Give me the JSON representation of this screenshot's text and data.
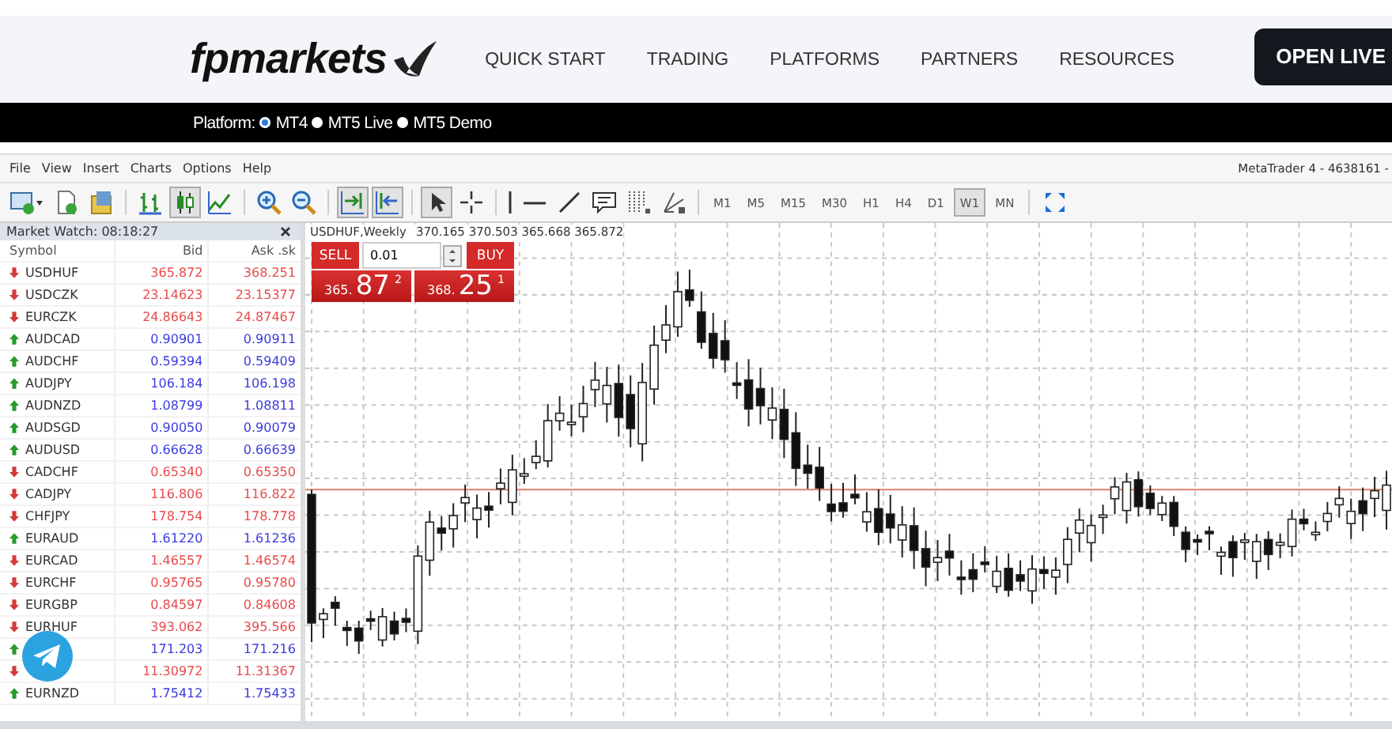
{
  "site": {
    "logo": "fpmarkets",
    "nav": [
      "QUICK START",
      "TRADING",
      "PLATFORMS",
      "PARTNERS",
      "RESOURCES"
    ],
    "cta": "OPEN LIVE",
    "platform_label": "Platform:",
    "platforms": [
      {
        "label": "MT4",
        "selected": true
      },
      {
        "label": "MT5 Live",
        "selected": false
      },
      {
        "label": "MT5 Demo",
        "selected": false
      }
    ]
  },
  "terminal": {
    "menu": [
      "File",
      "View",
      "Insert",
      "Charts",
      "Options",
      "Help"
    ],
    "title": "MetaTrader 4 - 4638161 -",
    "toolbar_groups": [
      [
        {
          "kind": "new-chart",
          "selected": false
        },
        {
          "kind": "document",
          "selected": false
        },
        {
          "kind": "folder",
          "selected": false
        }
      ],
      [
        {
          "kind": "bar-chart",
          "selected": false
        },
        {
          "kind": "candlestick",
          "selected": true
        },
        {
          "kind": "line-chart",
          "selected": false
        }
      ],
      [
        {
          "kind": "zoom-in",
          "selected": false
        },
        {
          "kind": "zoom-out",
          "selected": false
        }
      ],
      [
        {
          "kind": "autoscroll",
          "selected": true
        },
        {
          "kind": "chart-shift",
          "selected": true
        }
      ],
      [
        {
          "kind": "cursor",
          "selected": true
        },
        {
          "kind": "crosshair",
          "selected": false
        }
      ],
      [
        {
          "kind": "vertical-line",
          "selected": false
        },
        {
          "kind": "horizontal-line",
          "selected": false
        },
        {
          "kind": "trendline",
          "selected": false
        },
        {
          "kind": "text-label",
          "selected": false
        },
        {
          "kind": "grid-lines",
          "selected": false
        },
        {
          "kind": "fan",
          "selected": false
        }
      ]
    ],
    "timeframes": [
      {
        "label": "M1",
        "selected": false
      },
      {
        "label": "M5",
        "selected": false
      },
      {
        "label": "M15",
        "selected": false
      },
      {
        "label": "M30",
        "selected": false
      },
      {
        "label": "H1",
        "selected": false
      },
      {
        "label": "H4",
        "selected": false
      },
      {
        "label": "D1",
        "selected": false
      },
      {
        "label": "W1",
        "selected": true
      },
      {
        "label": "MN",
        "selected": false
      }
    ],
    "market_watch": {
      "title": "Market Watch: 08:18:27",
      "columns": [
        "Symbol",
        "Bid",
        "Ask .sk"
      ],
      "rows": [
        {
          "symbol": "USDHUF",
          "bid": "365.872",
          "ask": "368.251",
          "up": false
        },
        {
          "symbol": "USDCZK",
          "bid": "23.14623",
          "ask": "23.15377",
          "up": false
        },
        {
          "symbol": "EURCZK",
          "bid": "24.86643",
          "ask": "24.87467",
          "up": false
        },
        {
          "symbol": "AUDCAD",
          "bid": "0.90901",
          "ask": "0.90911",
          "up": true
        },
        {
          "symbol": "AUDCHF",
          "bid": "0.59394",
          "ask": "0.59409",
          "up": true
        },
        {
          "symbol": "AUDJPY",
          "bid": "106.184",
          "ask": "106.198",
          "up": true
        },
        {
          "symbol": "AUDNZD",
          "bid": "1.08799",
          "ask": "1.08811",
          "up": true
        },
        {
          "symbol": "AUDSGD",
          "bid": "0.90050",
          "ask": "0.90079",
          "up": true
        },
        {
          "symbol": "AUDUSD",
          "bid": "0.66628",
          "ask": "0.66639",
          "up": true
        },
        {
          "symbol": "CADCHF",
          "bid": "0.65340",
          "ask": "0.65350",
          "up": false
        },
        {
          "symbol": "CADJPY",
          "bid": "116.806",
          "ask": "116.822",
          "up": false
        },
        {
          "symbol": "CHFJPY",
          "bid": "178.754",
          "ask": "178.778",
          "up": false
        },
        {
          "symbol": "EURAUD",
          "bid": "1.61220",
          "ask": "1.61236",
          "up": true
        },
        {
          "symbol": "EURCAD",
          "bid": "1.46557",
          "ask": "1.46574",
          "up": false
        },
        {
          "symbol": "EURCHF",
          "bid": "0.95765",
          "ask": "0.95780",
          "up": false
        },
        {
          "symbol": "EURGBP",
          "bid": "0.84597",
          "ask": "0.84608",
          "up": false
        },
        {
          "symbol": "EURHUF",
          "bid": "393.062",
          "ask": "395.566",
          "up": false
        },
        {
          "bid": "171.203",
          "ask": "171.216",
          "up": true
        },
        {
          "bid": "11.30972",
          "ask": "11.31367",
          "up": false
        },
        {
          "symbol": "EURNZD",
          "bid": "1.75412",
          "ask": "1.75433",
          "up": true
        }
      ]
    },
    "chart": {
      "title": "USDHUF,Weekly",
      "ohlc": "370.165 370.503 365.668 365.872",
      "trade": {
        "sell": "SELL",
        "buy": "BUY",
        "lot": "0.01",
        "bid_prefix": "365.",
        "bid_main": "87",
        "bid_last": "2",
        "ask_prefix": "368.",
        "ask_main": "25",
        "ask_last": "1"
      }
    }
  }
}
